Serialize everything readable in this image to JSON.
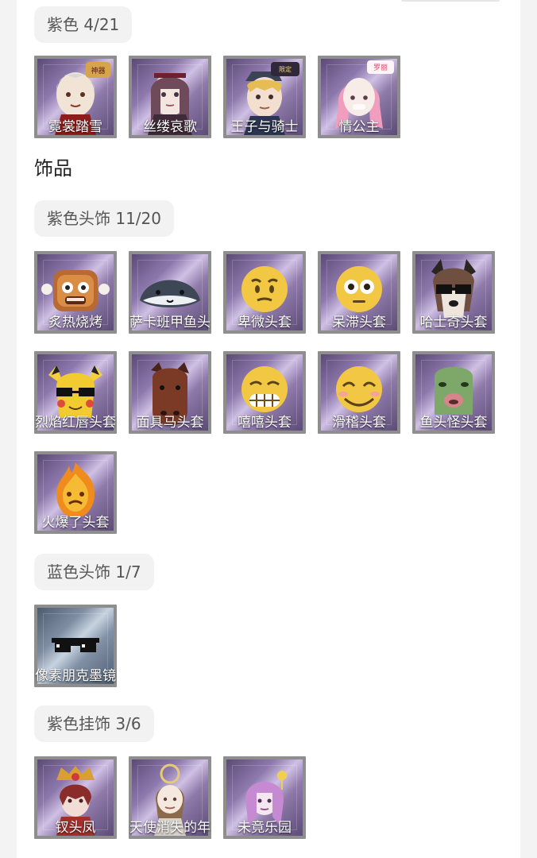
{
  "outfit_section": {
    "purple": {
      "label": "紫色 4/21",
      "items": [
        {
          "name": "霓裳踏雪",
          "icon": "costume-icon"
        },
        {
          "name": "丝缕哀歌",
          "icon": "costume-icon"
        },
        {
          "name": "王子与骑士",
          "icon": "costume-icon"
        },
        {
          "name": "情公主",
          "icon": "costume-icon"
        }
      ]
    }
  },
  "accessory_section": {
    "title": "饰品",
    "purple_headwear": {
      "label": "紫色头饰 11/20",
      "items": [
        {
          "name": "炙热烧烤",
          "icon": "toast-headgear-icon"
        },
        {
          "name": "萨卡班甲鱼头",
          "icon": "fish-headgear-icon"
        },
        {
          "name": "卑微头套",
          "icon": "emoji-headgear-icon"
        },
        {
          "name": "呆滞头套",
          "icon": "emoji-headgear-icon"
        },
        {
          "name": "哈士奇头套",
          "icon": "dog-headgear-icon"
        },
        {
          "name": "烈焰红唇头套",
          "icon": "pikachu-headgear-icon"
        },
        {
          "name": "面具马头套",
          "icon": "horse-headgear-icon"
        },
        {
          "name": "嘻嘻头套",
          "icon": "emoji-headgear-icon"
        },
        {
          "name": "滑稽头套",
          "icon": "emoji-headgear-icon"
        },
        {
          "name": "鱼头怪头套",
          "icon": "frog-headgear-icon"
        },
        {
          "name": "火爆了头套",
          "icon": "fire-headgear-icon"
        }
      ]
    },
    "blue_headwear": {
      "label": "蓝色头饰 1/7",
      "items": [
        {
          "name": "像素朋克墨镜",
          "icon": "pixel-sunglasses-icon"
        }
      ]
    },
    "purple_pendant": {
      "label": "紫色挂饰 3/6",
      "items": [
        {
          "name": "钗头凤",
          "icon": "pendant-icon"
        },
        {
          "name": "天使消失的年",
          "icon": "pendant-icon"
        },
        {
          "name": "未竟乐园",
          "icon": "pendant-icon"
        }
      ]
    }
  },
  "colors": {
    "page_background": "#f3f3f3",
    "panel_background": "#ffffff",
    "pill_background": "#f2f2f2",
    "purple_rarity": "#8e79ad",
    "blue_rarity": "#7f8ea3"
  }
}
